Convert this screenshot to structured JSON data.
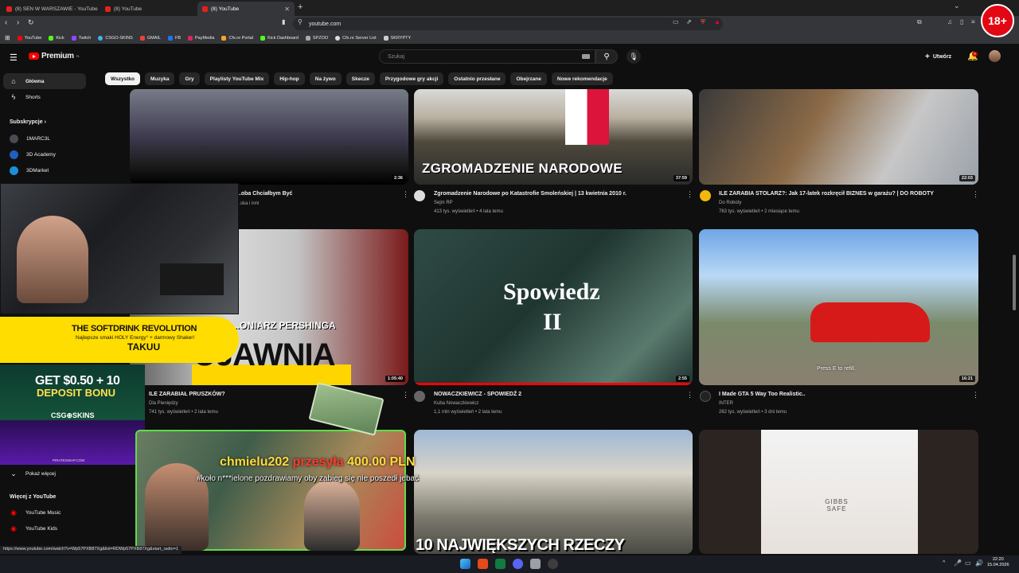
{
  "browser": {
    "tabs": [
      {
        "title": "(8) SEN W WARSZAWIE - YouTube"
      },
      {
        "title": "(8) YouTube"
      },
      {
        "title": "(8) YouTube"
      }
    ],
    "url": "youtube.com",
    "bookmarks": [
      "YouTube",
      "Kick",
      "Twitch",
      "CSGO-SKINS",
      "GMAIL",
      "FB",
      "PayMedia",
      "Cfx.re Portal",
      "Kick Dashboard",
      "SPZOO",
      "Cfx.re Server List",
      "SKRYPTY"
    ]
  },
  "youtube": {
    "logo": "Premium",
    "region": "PL",
    "search_placeholder": "Szukaj",
    "create_label": "Utwórz",
    "notifications": "9",
    "chips": [
      "Wszystko",
      "Muzyka",
      "Gry",
      "Playlisty YouTube Mix",
      "Hip-hop",
      "Na żywo",
      "Skecze",
      "Przygodowe gry akcji",
      "Ostatnio przesłane",
      "Obejrzane",
      "Nowe rekomendacje"
    ],
    "sidebar": {
      "main": [
        {
          "label": "Główna",
          "icon": "home-icon"
        },
        {
          "label": "Shorts",
          "icon": "shorts-icon"
        }
      ],
      "subs_title": "Subskrypcje",
      "subs": [
        "1MARC3L",
        "3D Academy",
        "3DMarket"
      ],
      "show_more": "Pokaż więcej",
      "more_title": "Więcej z YouTube",
      "more": [
        "YouTube Music",
        "YouTube Kids"
      ]
    },
    "videos": [
      {
        "title": "...oba Chciałbym Być",
        "channel": "...ska i inni",
        "meta": "",
        "duration": "2:36"
      },
      {
        "title": "Zgromadzenie Narodowe po Katastrofie Smoleńskiej | 13 kwietnia 2010 r.",
        "channel": "Sejm RP",
        "meta": "413 tys. wyświetleń • 4 lata temu",
        "duration": "37:59",
        "thumb_text": "ZGROMADZENIE NARODOWE"
      },
      {
        "title": "ILE ZARABIA STOLARZ?: Jak 17-latek rozkręcił BIZNES w garażu? | DO ROBOTY",
        "channel": "Do Roboty",
        "meta": "763 tys. wyświetleń • 2 miesiące temu",
        "duration": "22:03"
      },
      {
        "title": "ILE ZARABIAŁ PRUSZKÓW?",
        "channel": "Dla Pieniędzy",
        "meta": "741 tys. wyświetleń • 2 lata temu",
        "duration": "1:05:40",
        "thumb_text": "...ONIARZ PERSHINGA",
        "thumb_text2": "UJAWNIA"
      },
      {
        "title": "NOWACZKIEWICZ - SPOWIEDŹ 2",
        "channel": "Kuba Nowaczkiewicz",
        "meta": "1,1 mln wyświetleń • 2 lata temu",
        "duration": "2:55",
        "thumb_text": "Spowiedz",
        "thumb_text2": "II"
      },
      {
        "title": "I Made GTA 5 Way Too Realistic..",
        "channel": "INTER",
        "meta": "262 tys. wyświetleń • 3 dni temu",
        "duration": "16:21",
        "thumb_text": "Press E to refill."
      },
      {
        "title": "",
        "channel": "",
        "meta": "",
        "duration": ""
      },
      {
        "title": "",
        "channel": "",
        "meta": "",
        "duration": "",
        "thumb_text": "10 NAJWIĘKSZYCH RZECZY"
      },
      {
        "title": "",
        "channel": "",
        "meta": "",
        "duration": "",
        "thumb_text": "GIBBS SAFE"
      }
    ]
  },
  "overlays": {
    "badge": "18+",
    "promo_title": "THE SOFTDRINK REVOLUTION",
    "promo_sub": "Najlepsze smaki HOLY Energy° + darmowy Shaker!",
    "promo_code": "TAKUU",
    "csgo_line1": "GET $0.50 + 10",
    "csgo_line2": "DEPOSIT BONU",
    "csgo_brand": "CSG⊕SKINS",
    "csgo_footer": "PIRATESWAP.COM",
    "donor_name": "chmielu202",
    "donor_verb": "przesyła",
    "donor_amount": "400.00",
    "donor_currency": "PLN",
    "donor_message": "#koło n***ielone pozdrawiamy oby zabieg się nie poszedł jebać"
  },
  "status_url": "https://www.youtube.com/watch?v=Wp57PXB87Xg&list=RDWp57PXB87Xg&start_radio=1",
  "clock": {
    "time": "22:20",
    "date": "15.04.2026"
  }
}
